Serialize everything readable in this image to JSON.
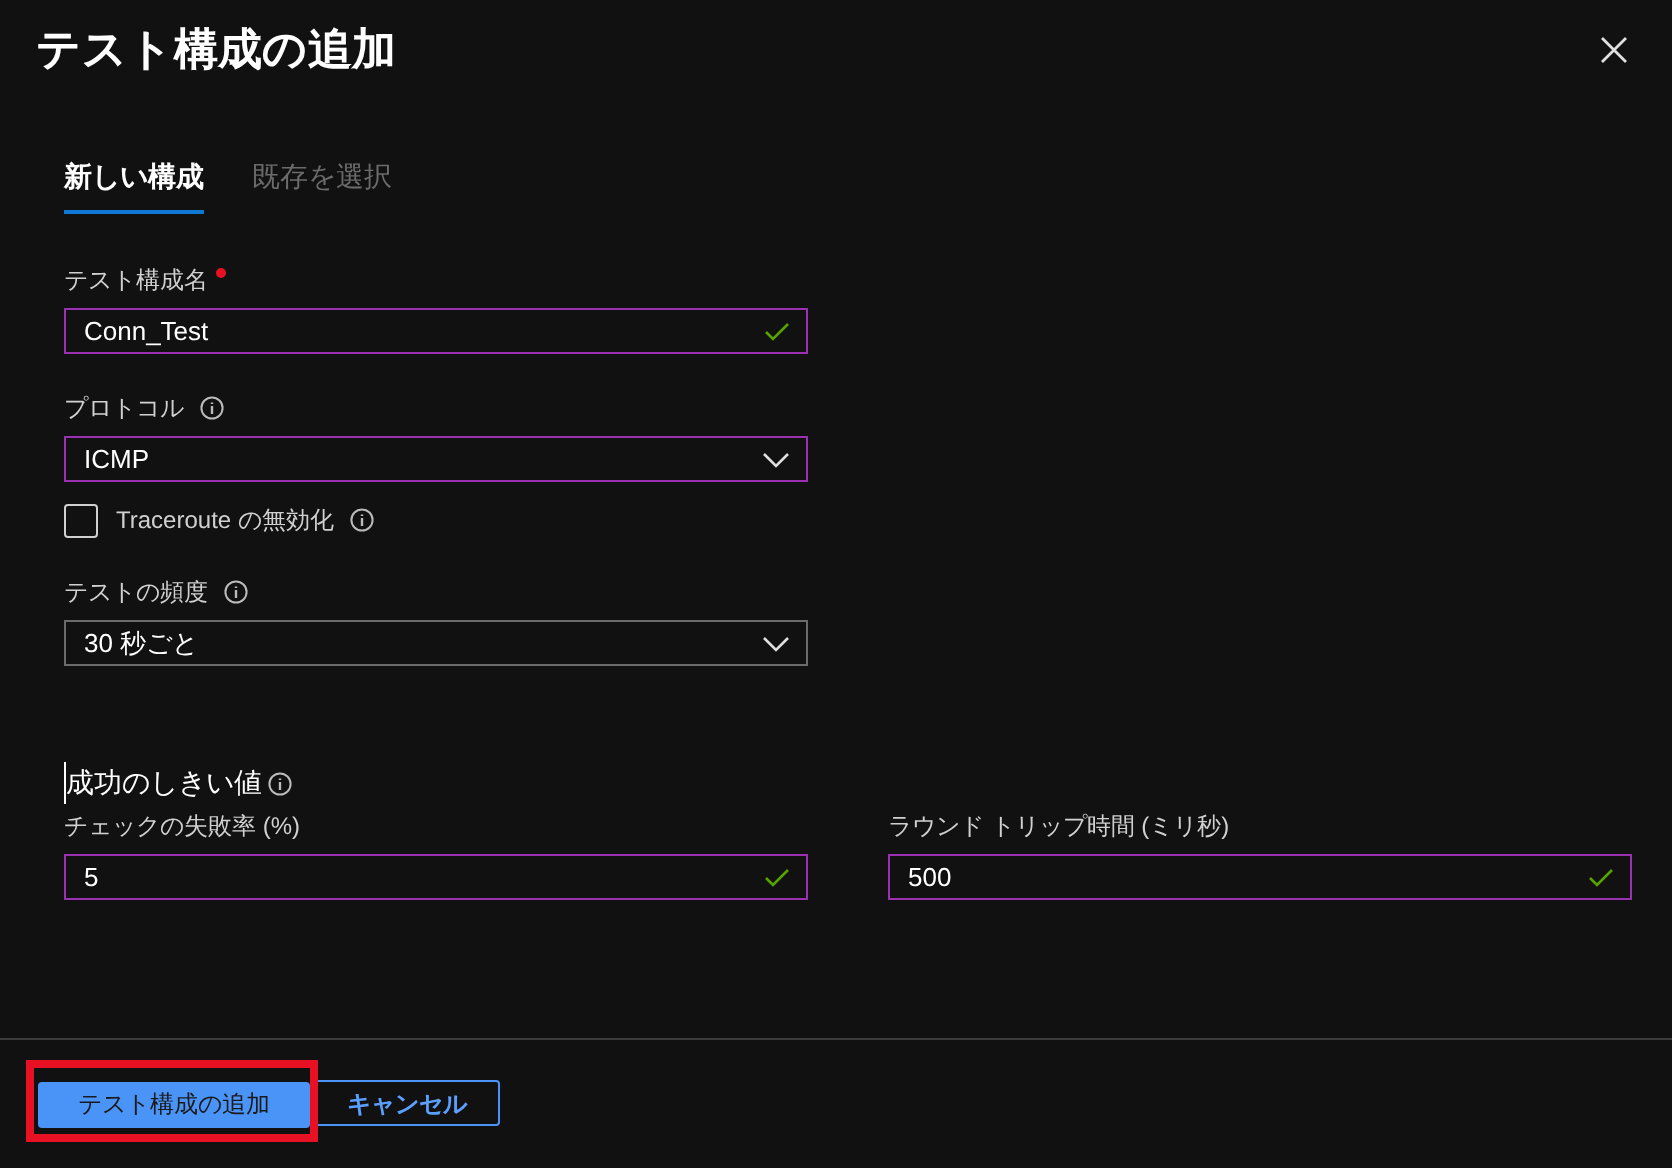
{
  "panel": {
    "title": "テスト構成の追加"
  },
  "tabs": [
    {
      "label": "新しい構成",
      "selected": true
    },
    {
      "label": "既存を選択",
      "selected": false
    }
  ],
  "fields": [
    {
      "kind": "text",
      "label": "テスト構成名",
      "required": true,
      "info": false,
      "value": "Conn_Test",
      "valid": true
    },
    {
      "kind": "select",
      "label": "プロトコル",
      "required": false,
      "info": true,
      "value": "ICMP"
    },
    {
      "kind": "checkbox",
      "label": "Traceroute の無効化",
      "info": true,
      "checked": false
    },
    {
      "kind": "select",
      "label": "テストの頻度",
      "required": false,
      "info": true,
      "value": "30 秒ごと"
    }
  ],
  "threshold": {
    "heading": "成功のしきい値",
    "fields": [
      {
        "label": "チェックの失敗率 (%)",
        "value": "5",
        "valid": true
      },
      {
        "label": "ラウンド トリップ時間 (ミリ秒)",
        "value": "500",
        "valid": true
      }
    ]
  },
  "buttons": [
    {
      "label": "テスト構成の追加",
      "kind": "primary",
      "highlighted": true
    },
    {
      "label": "キャンセル",
      "kind": "secondary",
      "highlighted": false
    }
  ]
}
